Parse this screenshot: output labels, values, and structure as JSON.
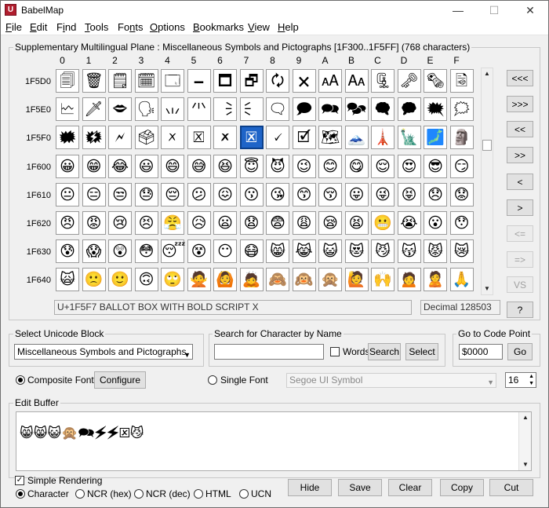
{
  "window": {
    "title": "BabelMap",
    "app_icon": "U",
    "minimize_icon": "minimize-icon",
    "maximize_icon": "maximize-icon",
    "close_icon": "close-icon"
  },
  "menu": [
    "File",
    "Edit",
    "Find",
    "Tools",
    "Fonts",
    "Options",
    "Bookmarks",
    "View",
    "Help"
  ],
  "menu_mnemonics": [
    "F",
    "E",
    "i",
    "T",
    "n",
    "O",
    "B",
    "V",
    "H"
  ],
  "grid": {
    "title": "Supplementary Multilingual Plane : Miscellaneous Symbols and Pictographs [1F300..1F5FF] (768 characters)",
    "columns": [
      "0",
      "1",
      "2",
      "3",
      "4",
      "5",
      "6",
      "7",
      "8",
      "9",
      "A",
      "B",
      "C",
      "D",
      "E",
      "F"
    ],
    "rows": [
      {
        "label": "1F5D0",
        "chars": [
          "🗐",
          "🗑",
          "🗒",
          "🗓",
          "🗔",
          "🗕",
          "🗖",
          "🗗",
          "🗘",
          "🗙",
          "🗚",
          "🗛",
          "🗜",
          "🗝",
          "🗞",
          "🗟"
        ]
      },
      {
        "label": "1F5E0",
        "chars": [
          "🗠",
          "🗡",
          "🗢",
          "🗣",
          "🗤",
          "🗥",
          "🗦",
          "🗧",
          "🗨",
          "🗩",
          "🗪",
          "🗫",
          "🗬",
          "🗭",
          "🗮",
          "🗯"
        ]
      },
      {
        "label": "1F5F0",
        "chars": [
          "🗰",
          "🗱",
          "🗲",
          "🗳",
          "🗴",
          "🗵",
          "🗶",
          "🗷",
          "🗸",
          "🗹",
          "🗺",
          "🗻",
          "🗼",
          "🗽",
          "🗾",
          "🗿"
        ]
      },
      {
        "label": "1F600",
        "chars": [
          "😀",
          "😁",
          "😂",
          "😃",
          "😄",
          "😅",
          "😆",
          "😇",
          "😈",
          "😉",
          "😊",
          "😋",
          "😌",
          "😍",
          "😎",
          "😏"
        ]
      },
      {
        "label": "1F610",
        "chars": [
          "😐",
          "😑",
          "😒",
          "😓",
          "😔",
          "😕",
          "😖",
          "😗",
          "😘",
          "😙",
          "😚",
          "😛",
          "😜",
          "😝",
          "😞",
          "😟"
        ]
      },
      {
        "label": "1F620",
        "chars": [
          "😠",
          "😡",
          "😢",
          "😣",
          "😤",
          "😥",
          "😦",
          "😧",
          "😨",
          "😩",
          "😪",
          "😫",
          "😬",
          "😭",
          "😮",
          "😯"
        ]
      },
      {
        "label": "1F630",
        "chars": [
          "😰",
          "😱",
          "😲",
          "😳",
          "😴",
          "😵",
          "😶",
          "😷",
          "😸",
          "😹",
          "😺",
          "😻",
          "😼",
          "😽",
          "😾",
          "😿"
        ]
      },
      {
        "label": "1F640",
        "chars": [
          "🙀",
          "🙁",
          "🙂",
          "🙃",
          "🙄",
          "🙅",
          "🙆",
          "🙇",
          "🙈",
          "🙉",
          "🙊",
          "🙋",
          "🙌",
          "🙍",
          "🙎",
          "🙏"
        ]
      }
    ],
    "selected": {
      "row": 2,
      "col": 7
    },
    "status_name": "U+1F5F7 BALLOT BOX WITH BOLD SCRIPT X",
    "status_decimal": "Decimal 128503"
  },
  "nav_buttons": [
    "<<<",
    ">>>",
    "<<",
    ">>",
    "<",
    ">",
    "<=",
    "=>",
    "VS",
    "?"
  ],
  "nav_disabled": [
    false,
    false,
    false,
    false,
    false,
    false,
    true,
    true,
    true,
    false
  ],
  "unicode_block": {
    "label": "Select Unicode Block",
    "value": "Miscellaneous Symbols and Pictographs"
  },
  "search": {
    "label": "Search for Character by Name",
    "value": "",
    "words_label": "Words",
    "words_checked": false,
    "search_button": "Search",
    "select_button": "Select"
  },
  "goto": {
    "label": "Go to Code Point",
    "value": "$0000",
    "button": "Go"
  },
  "font": {
    "composite_label": "Composite Font",
    "composite_selected": true,
    "configure_button": "Configure",
    "single_label": "Single Font",
    "single_value": "Segoe UI Symbol",
    "size": "16"
  },
  "buffer": {
    "label": "Edit Buffer",
    "content": "😸😸😺🙊🗪🗲🗲🗵😼"
  },
  "bottom": {
    "simple_rendering_label": "Simple Rendering",
    "simple_rendering_checked": true,
    "formats": [
      "Character",
      "NCR (hex)",
      "NCR (dec)",
      "HTML",
      "UCN"
    ],
    "selected_format": 0,
    "buttons": [
      "Hide",
      "Save",
      "Clear",
      "Copy",
      "Cut"
    ]
  }
}
